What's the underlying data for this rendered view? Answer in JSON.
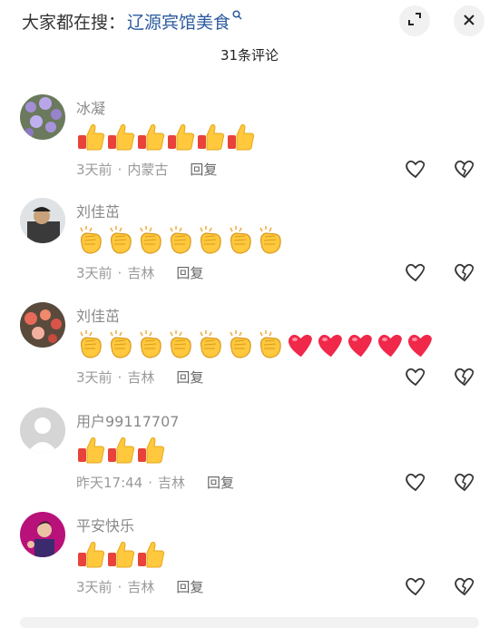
{
  "header": {
    "search_prefix": "大家都在搜：",
    "search_term": "辽源宾馆美食",
    "comment_count": "31条评论"
  },
  "comments": [
    {
      "username": "冰凝",
      "time": "3天前",
      "location": "内蒙古",
      "reply_label": "回复",
      "emojis": [
        "thumbs-up",
        "thumbs-up",
        "thumbs-up",
        "thumbs-up",
        "thumbs-up",
        "thumbs-up"
      ],
      "avatar": "flowers"
    },
    {
      "username": "刘佳茁",
      "time": "3天前",
      "location": "吉林",
      "reply_label": "回复",
      "emojis": [
        "clap",
        "clap",
        "clap",
        "clap",
        "clap",
        "clap",
        "clap"
      ],
      "avatar": "person-cap"
    },
    {
      "username": "刘佳茁",
      "time": "3天前",
      "location": "吉林",
      "reply_label": "回复",
      "emojis": [
        "clap",
        "clap",
        "clap",
        "clap",
        "clap",
        "clap",
        "clap",
        "heart",
        "heart",
        "heart",
        "heart",
        "heart"
      ],
      "avatar": "flowers-red"
    },
    {
      "username": "用户99117707",
      "time": "昨天17:44",
      "location": "吉林",
      "reply_label": "回复",
      "emojis": [
        "thumbs-up",
        "thumbs-up",
        "thumbs-up"
      ],
      "avatar": "default"
    },
    {
      "username": "平安快乐",
      "time": "3天前",
      "location": "吉林",
      "reply_label": "回复",
      "emojis": [
        "thumbs-up",
        "thumbs-up",
        "thumbs-up"
      ],
      "avatar": "person-pink"
    }
  ]
}
